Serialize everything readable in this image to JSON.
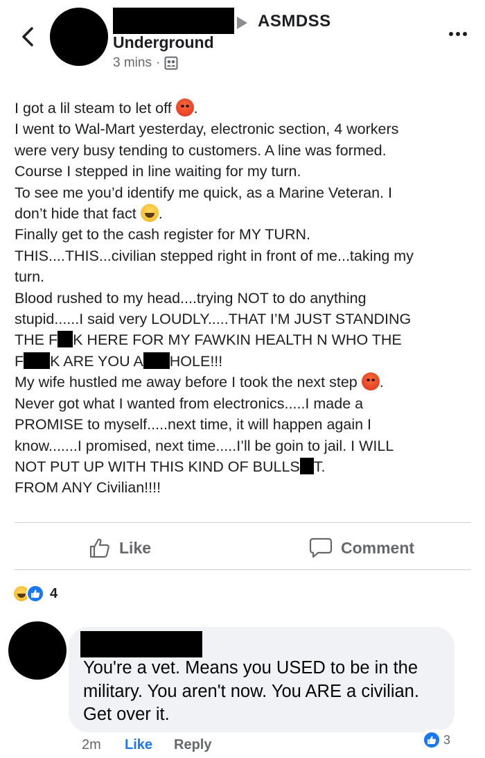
{
  "header": {
    "back_icon": "chevron-left-icon",
    "author_name": "Underground",
    "group_name": "ASMDSS",
    "time": "3 mins",
    "separator": "·",
    "audience_icon": "group-audience-icon",
    "more_icon": "more-options-icon"
  },
  "post": {
    "line1": "I got a lil steam to let off",
    "line1_end": ".",
    "line2": "I went to Wal-Mart yesterday, electronic section, 4 workers",
    "line3": "were very busy tending to customers. A line was formed.",
    "line4": "Course I stepped in line waiting for my turn.",
    "line5": "To see me you’d identify me quick, as a Marine Veteran. I",
    "line6": "don’t hide that fact",
    "line6_end": ".",
    "line7": "Finally get to the cash register for MY TURN.",
    "line8": "THIS....THIS...civilian stepped right in front of me...taking my",
    "line9": "turn.",
    "line10": "Blood rushed to my head....trying NOT to do anything",
    "line11": "stupid......I said very LOUDLY.....THAT I’M JUST STANDING",
    "line12a": "THE F",
    "line12b": "K HERE FOR MY FAWKIN HEALTH N WHO THE",
    "line13a": "F",
    "line13b": "K ARE YOU A",
    "line13c": "HOLE!!!",
    "line14": "My wife hustled me away before I took the next step",
    "line14_end": ".",
    "line15": "Never got what I wanted from electronics.....I made a",
    "line16": "PROMISE to myself.....next time, it will happen again I",
    "line17": "know.......I promised, next time.....I’ll be goin to jail. I WILL",
    "line18a": "NOT PUT UP WITH THIS KIND OF BULLS",
    "line18b": "T.",
    "line19": "FROM ANY Civilian!!!!"
  },
  "actions": {
    "like_label": "Like",
    "comment_label": "Comment"
  },
  "reactions": {
    "count": "4"
  },
  "comment": {
    "text_line1": "You're a vet. Means you USED to be in the",
    "text_line2": "military. You aren't now. You ARE a civilian.",
    "text_line3": "Get over it.",
    "time": "2m",
    "like_label": "Like",
    "reply_label": "Reply",
    "reaction_count": "3"
  },
  "colors": {
    "link_blue": "#1877f2",
    "muted_gray": "#65676b",
    "bubble_bg": "#f0f2f5"
  }
}
